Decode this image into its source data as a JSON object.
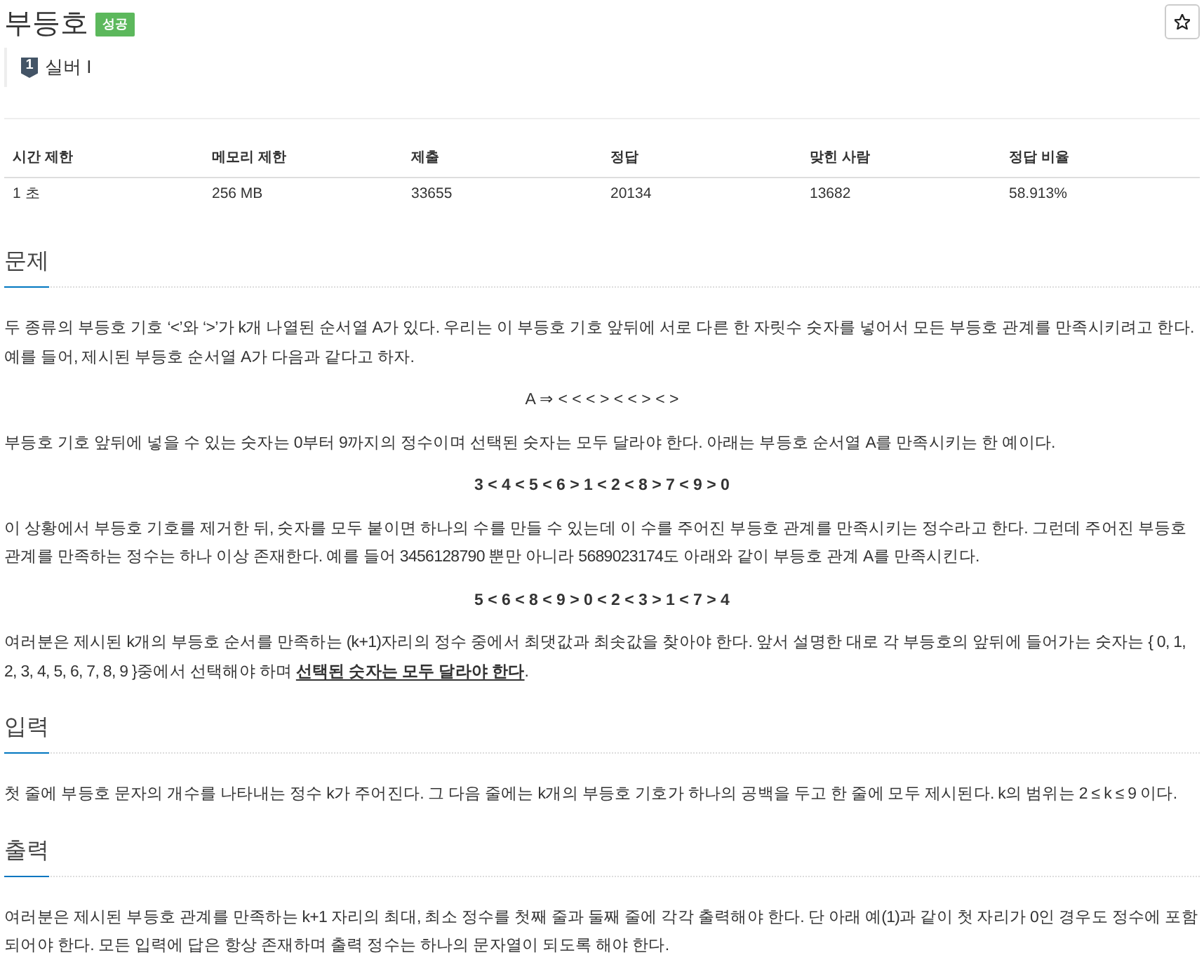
{
  "problem": {
    "title": "부등호",
    "status": "성공",
    "tier": {
      "number": "1",
      "label": "실버 I"
    }
  },
  "info_table": {
    "columns": [
      "시간 제한",
      "메모리 제한",
      "제출",
      "정답",
      "맞힌 사람",
      "정답 비율"
    ],
    "rows": [
      [
        "1 초",
        "256 MB",
        "33655",
        "20134",
        "13682",
        "58.913%"
      ]
    ]
  },
  "sections": [
    {
      "heading": "문제",
      "blocks": [
        {
          "kind": "paragraph",
          "text": "두 종류의 부등호 기호 ‘<’와 ‘>’가 k개 나열된 순서열 A가 있다. 우리는 이 부등호 기호 앞뒤에 서로 다른 한 자릿수 숫자를 넣어서 모든 부등호 관계를 만족시키려고 한다. 예를 들어, 제시된 부등호 순서열 A가 다음과 같다고 하자."
        },
        {
          "kind": "display",
          "bold": false,
          "text": "A ⇒ < < < > < < > < >"
        },
        {
          "kind": "paragraph",
          "text": "부등호 기호 앞뒤에 넣을 수 있는 숫자는 0부터 9까지의 정수이며 선택된 숫자는 모두 달라야 한다. 아래는 부등호 순서열 A를 만족시키는 한 예이다."
        },
        {
          "kind": "display",
          "bold": true,
          "text": "3 < 4 < 5 < 6 > 1 < 2 < 8 > 7 < 9 > 0"
        },
        {
          "kind": "paragraph",
          "text": "이 상황에서 부등호 기호를 제거한 뒤, 숫자를 모두 붙이면 하나의 수를 만들 수 있는데 이 수를 주어진 부등호 관계를 만족시키는 정수라고 한다. 그런데 주어진 부등호 관계를 만족하는 정수는 하나 이상 존재한다. 예를 들어 3456128790 뿐만 아니라 5689023174도 아래와 같이 부등호 관계 A를 만족시킨다."
        },
        {
          "kind": "display",
          "bold": true,
          "text": "5 < 6 < 8 < 9 > 0 < 2 < 3 > 1 < 7 > 4"
        },
        {
          "kind": "paragraph",
          "text": "여러분은 제시된 k개의 부등호 순서를 만족하는 (k+1)자리의 정수 중에서 최댓값과 최솟값을 찾아야 한다. 앞서 설명한 대로 각 부등호의 앞뒤에 들어가는 숫자는 { 0, 1, 2, 3, 4, 5, 6, 7, 8, 9 }중에서 선택해야 하며 **선택된 숫자는 모두 달라야 한다**."
        }
      ]
    },
    {
      "heading": "입력",
      "blocks": [
        {
          "kind": "paragraph",
          "text": "첫 줄에 부등호 문자의 개수를 나타내는 정수 k가 주어진다. 그 다음 줄에는 k개의 부등호 기호가 하나의 공백을 두고 한 줄에 모두 제시된다. k의 범위는 2 ≤ k ≤ 9 이다."
        }
      ]
    },
    {
      "heading": "출력",
      "blocks": [
        {
          "kind": "paragraph",
          "text": "여러분은 제시된 부등호 관계를 만족하는 k+1 자리의 최대, 최소 정수를 첫째 줄과 둘째 줄에 각각 출력해야 한다. 단 아래 예(1)과 같이 첫 자리가 0인 경우도 정수에 포함되어야 한다. 모든 입력에 답은 항상 존재하며 출력 정수는 하나의 문자열이 되도록 해야 한다."
        }
      ]
    }
  ]
}
